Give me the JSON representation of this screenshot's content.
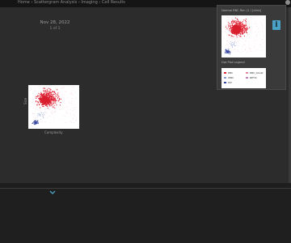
{
  "breadcrumb": "Home › Scattergram Analysis › Imaging › Cell Results",
  "report": {
    "date": "Nov 28, 2022",
    "page_of": "1 of 1"
  },
  "main_plot": {
    "ylabel": "Size",
    "xlabel": "Complexity"
  },
  "popup": {
    "title": "Normal RBC Run (1 ) [click]",
    "legend_title": "Dot Plot Legend",
    "legend": [
      {
        "label": "RBC",
        "color": "#e0283a"
      },
      {
        "label": "RBC_Ghost",
        "color": "#e08aa0"
      },
      {
        "label": "WBC",
        "color": "#8a9ad0"
      },
      {
        "label": "RETIC",
        "color": "#c080c0"
      },
      {
        "label": "PLT",
        "color": "#3a4aa0"
      }
    ]
  },
  "info_label": "i",
  "colors": {
    "background": "#2c2c2c",
    "accent": "#4aa3c6",
    "rbc": "#e0283a",
    "plt": "#3a4aa0"
  }
}
